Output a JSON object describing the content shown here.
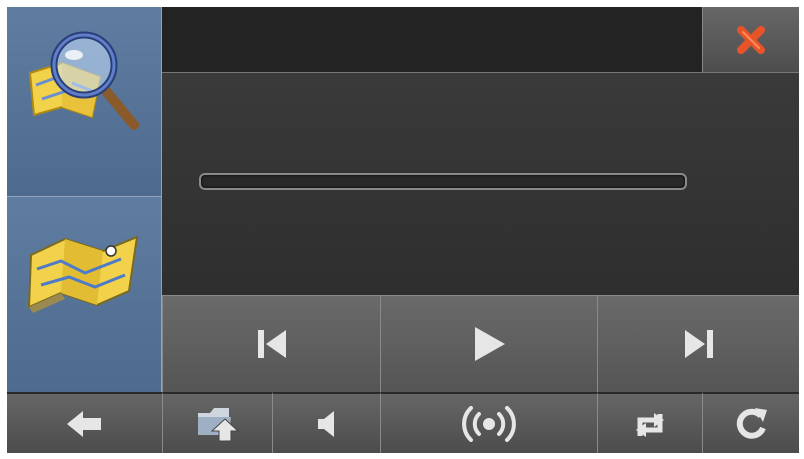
{
  "window": {
    "title": "",
    "progress_fraction": 0.0
  },
  "sidebar": {
    "items": [
      {
        "icon": "map-search-icon"
      },
      {
        "icon": "map-icon"
      }
    ]
  },
  "header": {
    "close_icon": "close-icon"
  },
  "playback": {
    "buttons": [
      {
        "icon": "previous-track-icon"
      },
      {
        "icon": "play-icon"
      },
      {
        "icon": "next-track-icon"
      }
    ]
  },
  "bottom_bar": {
    "buttons": [
      {
        "icon": "back-arrow-icon"
      },
      {
        "icon": "folder-upload-icon"
      },
      {
        "icon": "volume-icon"
      },
      {
        "icon": "broadcast-icon"
      },
      {
        "icon": "repeat-icon"
      },
      {
        "icon": "refresh-icon"
      }
    ]
  },
  "colors": {
    "sidebar": "#5f7da1",
    "close_accent": "#e8542a",
    "icon_fg": "#e6e6e6"
  }
}
